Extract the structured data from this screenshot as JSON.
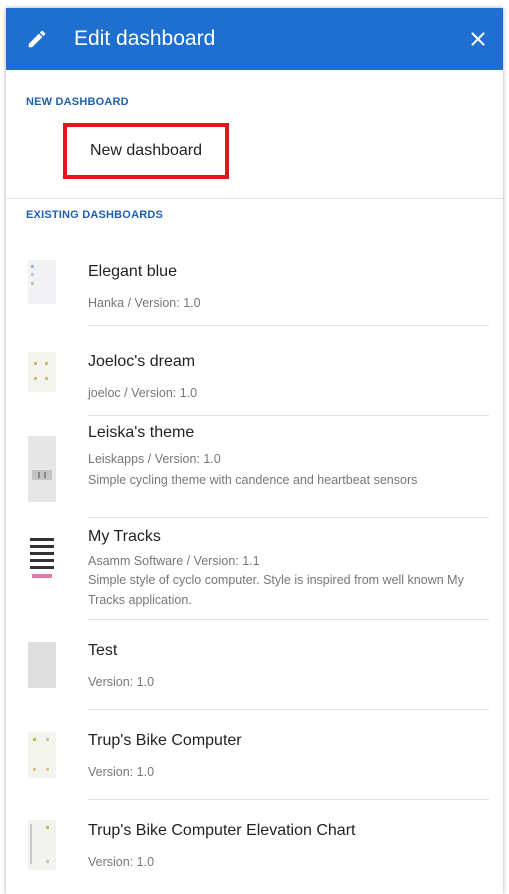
{
  "header": {
    "title": "Edit dashboard",
    "bg_color": "#1f6fd0",
    "edit_icon": "pencil-icon",
    "close_icon": "close-icon"
  },
  "new_section": {
    "title": "NEW DASHBOARD",
    "button_label": "New dashboard",
    "highlight_color": "#e3161c"
  },
  "existing_section": {
    "title": "EXISTING DASHBOARDS",
    "items": [
      {
        "name": "Elegant blue",
        "meta": "Hanka / Version: 1.0",
        "desc": ""
      },
      {
        "name": "Joeloc's dream",
        "meta": "joeloc / Version: 1.0",
        "desc": ""
      },
      {
        "name": "Leiska's theme",
        "meta": "Leiskapps / Version: 1.0",
        "desc": "Simple cycling theme with candence and heartbeat sensors"
      },
      {
        "name": "My Tracks",
        "meta": "Asamm Software / Version: 1.1",
        "desc": "Simple style of cyclo computer. Style is inspired from well known My Tracks application."
      },
      {
        "name": "Test",
        "meta": "Version: 1.0",
        "desc": ""
      },
      {
        "name": "Trup's Bike Computer",
        "meta": "Version: 1.0",
        "desc": ""
      },
      {
        "name": "Trup's Bike Computer Elevation Chart",
        "meta": "Version: 1.0",
        "desc": ""
      }
    ]
  }
}
